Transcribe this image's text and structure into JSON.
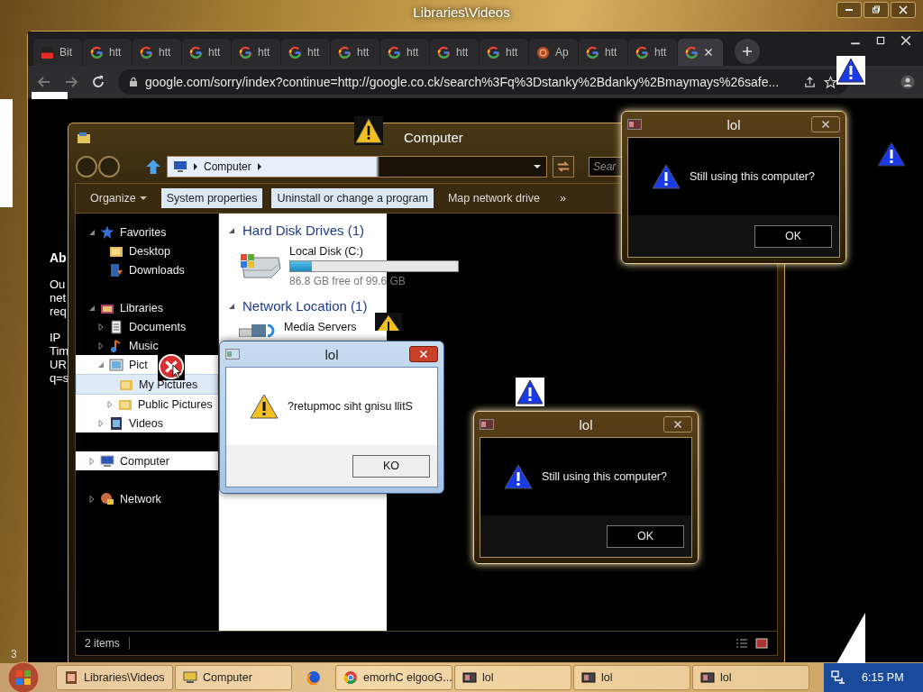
{
  "outer_window": {
    "title": "Libraries\\Videos"
  },
  "browser": {
    "tabs": [
      {
        "label": "Bit",
        "kind": "video",
        "selected": false
      },
      {
        "label": "htt",
        "kind": "google",
        "selected": false
      },
      {
        "label": "htt",
        "kind": "google",
        "selected": false
      },
      {
        "label": "htt",
        "kind": "google",
        "selected": false
      },
      {
        "label": "htt",
        "kind": "google",
        "selected": false
      },
      {
        "label": "htt",
        "kind": "google",
        "selected": false
      },
      {
        "label": "htt",
        "kind": "google",
        "selected": false
      },
      {
        "label": "htt",
        "kind": "google",
        "selected": false
      },
      {
        "label": "htt",
        "kind": "google",
        "selected": false
      },
      {
        "label": "htt",
        "kind": "google",
        "selected": false
      },
      {
        "label": "Ap",
        "kind": "app",
        "selected": false
      },
      {
        "label": "htt",
        "kind": "google",
        "selected": false
      },
      {
        "label": "htt",
        "kind": "google",
        "selected": false
      },
      {
        "kind": "google",
        "selected": true
      }
    ],
    "url": "google.com/sorry/index?continue=http://google.co.ck/search%3Fq%3Dstanky%2Bdanky%2Bmaymays%26safe...",
    "page_fragments": [
      {
        "text": "Ab",
        "kind": "heading"
      },
      {
        "text": "Ou",
        "kind": "line"
      },
      {
        "text": "net",
        "kind": "line"
      },
      {
        "text": "req",
        "kind": "line"
      },
      {
        "text": "IP",
        "kind": "gap"
      },
      {
        "text": "Tim",
        "kind": "line"
      },
      {
        "text": "UR",
        "kind": "line"
      },
      {
        "text": "q=s",
        "kind": "line"
      }
    ],
    "corner_text": "3"
  },
  "explorer": {
    "title": "Computer",
    "breadcrumb": "Computer",
    "search": {
      "placeholder": "Sear"
    },
    "toolbar": [
      {
        "label": "Organize",
        "menu": true
      },
      {
        "label": "System properties",
        "menu": false
      },
      {
        "label": "Uninstall or change a program",
        "menu": false
      },
      {
        "label": "Map network drive",
        "menu": false
      },
      {
        "label": "»",
        "menu": false
      }
    ],
    "nav": [
      {
        "label": "Favorites",
        "kind": "star",
        "expanded": true,
        "selected": false,
        "children": [
          {
            "label": "Desktop",
            "kind": "folder",
            "selected": false
          },
          {
            "label": "Downloads",
            "kind": "download",
            "selected": false
          }
        ]
      },
      {
        "label": "Libraries",
        "kind": "library",
        "expanded": true,
        "selected": false,
        "children": [
          {
            "label": "Documents",
            "kind": "document",
            "expanded": false,
            "selected": false
          },
          {
            "label": "Music",
            "kind": "music",
            "expanded": false,
            "selected": false
          },
          {
            "label": "Pict",
            "kind": "pictures",
            "expanded": true,
            "selected": false,
            "children": [
              {
                "label": "My Pictures",
                "kind": "folder",
                "selected": true
              },
              {
                "label": "Public Pictures",
                "kind": "folder",
                "expanded": false,
                "selected": false
              }
            ]
          },
          {
            "label": "Videos",
            "kind": "video",
            "expanded": false,
            "selected": false
          }
        ]
      },
      {
        "label": "Computer",
        "kind": "computer",
        "expanded": false,
        "selected": false
      },
      {
        "label": "Network",
        "kind": "network",
        "expanded": false,
        "selected": false
      }
    ],
    "sections": [
      {
        "title": "Hard Disk Drives (1)",
        "items": [
          {
            "name": "Local Disk (C:)",
            "kind": "drive",
            "level": 0.13,
            "detail": "86.8 GB free of 99.6 GB"
          }
        ]
      },
      {
        "title": "Network Location (1)",
        "items": [
          {
            "name": "Media Servers",
            "kind": "media"
          }
        ]
      }
    ],
    "status": "2 items"
  },
  "dialogs": [
    {
      "kind": "dark",
      "title": "lol",
      "message": "Still using this computer?",
      "button": "OK"
    },
    {
      "kind": "light",
      "title": "lol",
      "message": "?retupmoc siht gnisu llitS",
      "button": "KO"
    },
    {
      "kind": "dark",
      "title": "lol",
      "message": "Still using this computer?",
      "button": "OK"
    }
  ],
  "taskbar": {
    "items": [
      {
        "kind": "video",
        "label": "Libraries\\Videos"
      },
      {
        "kind": "computer",
        "label": "Computer"
      },
      {
        "kind": "firefox"
      },
      {
        "kind": "chrome",
        "label": "emorhC elgooG..."
      },
      {
        "kind": "dialog",
        "label": "lol"
      },
      {
        "kind": "dialog",
        "label": "lol"
      },
      {
        "kind": "dialog",
        "label": "lol"
      }
    ],
    "clock": "6:15 PM"
  }
}
